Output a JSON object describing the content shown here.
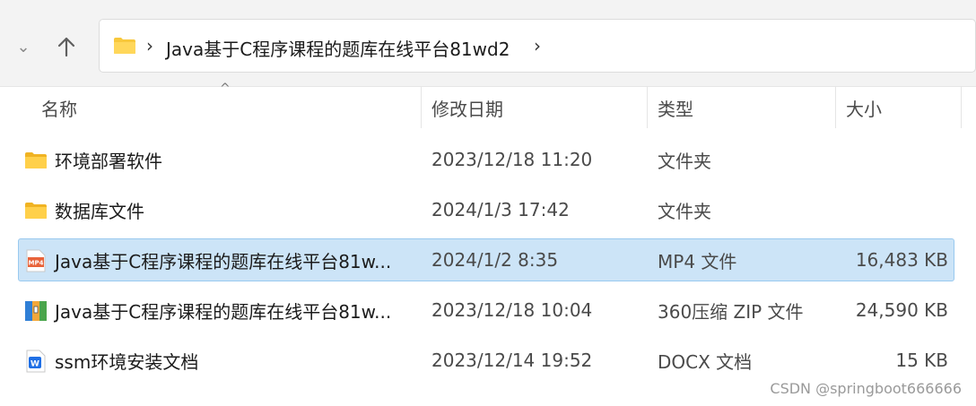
{
  "nav": {
    "recent_icon": "chevron-down-icon",
    "up_icon": "arrow-up-icon"
  },
  "address": {
    "path": "Java基于C程序课程的题库在线平台81wd2",
    "folder_icon": "folder-icon"
  },
  "columns": {
    "name": "名称",
    "date": "修改日期",
    "type": "类型",
    "size": "大小"
  },
  "files": [
    {
      "name": "环境部署软件",
      "date": "2023/12/18 11:20",
      "type": "文件夹",
      "size": "",
      "icon": "folder-icon",
      "selected": false
    },
    {
      "name": "数据库文件",
      "date": "2024/1/3 17:42",
      "type": "文件夹",
      "size": "",
      "icon": "folder-icon",
      "selected": false
    },
    {
      "name": "Java基于C程序课程的题库在线平台81w...",
      "date": "2024/1/2 8:35",
      "type": "MP4 文件",
      "size": "16,483 KB",
      "icon": "mp4-file-icon",
      "selected": true
    },
    {
      "name": "Java基于C程序课程的题库在线平台81w...",
      "date": "2023/12/18 10:04",
      "type": "360压缩 ZIP 文件",
      "size": "24,590 KB",
      "icon": "zip-archive-icon",
      "selected": false
    },
    {
      "name": "ssm环境安装文档",
      "date": "2023/12/14 19:52",
      "type": "DOCX 文档",
      "size": "15 KB",
      "icon": "word-document-icon",
      "selected": false
    }
  ],
  "watermark": "CSDN @springboot666666",
  "colors": {
    "selection_bg": "#cce4f7",
    "selection_border": "#99c9ef",
    "folder": "#f8c83c"
  }
}
